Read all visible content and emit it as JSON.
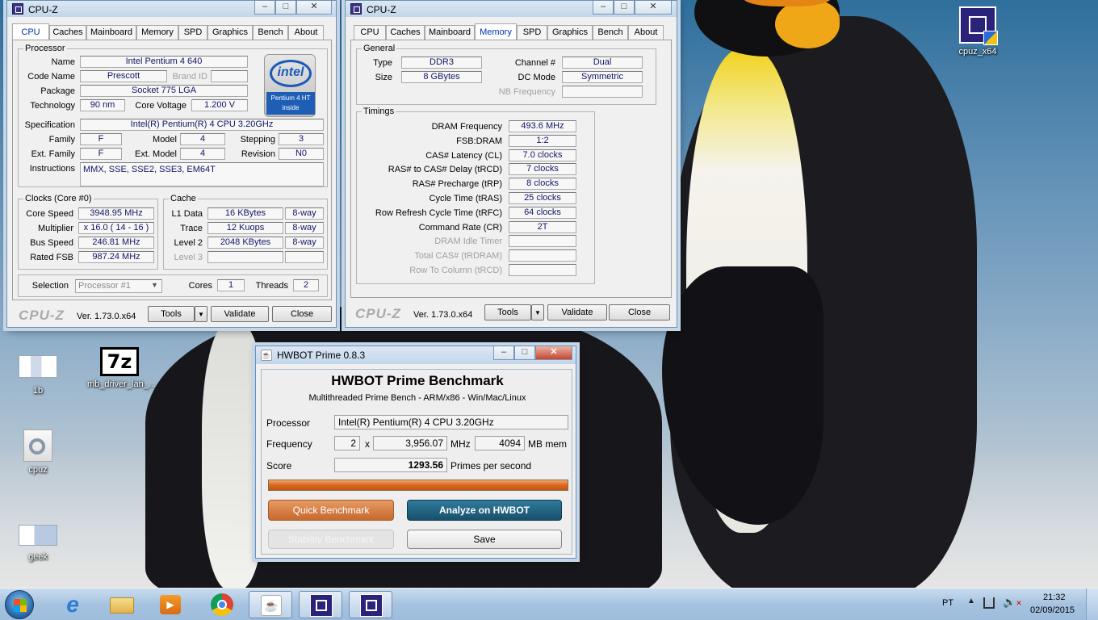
{
  "cpuz_cpu": {
    "title": "CPU-Z",
    "tabs": [
      "CPU",
      "Caches",
      "Mainboard",
      "Memory",
      "SPD",
      "Graphics",
      "Bench",
      "About"
    ],
    "processor": {
      "group_title": "Processor",
      "name_label": "Name",
      "name": "Intel Pentium 4 640",
      "codename_label": "Code Name",
      "codename": "Prescott",
      "brandid_label": "Brand ID",
      "package_label": "Package",
      "package": "Socket 775 LGA",
      "technology_label": "Technology",
      "technology": "90 nm",
      "corevoltage_label": "Core Voltage",
      "corevoltage": "1.200 V",
      "spec_label": "Specification",
      "spec": "Intel(R) Pentium(R) 4 CPU 3.20GHz",
      "family_label": "Family",
      "family": "F",
      "model_label": "Model",
      "model": "4",
      "stepping_label": "Stepping",
      "stepping": "3",
      "extfamily_label": "Ext. Family",
      "extfamily": "F",
      "extmodel_label": "Ext. Model",
      "extmodel": "4",
      "revision_label": "Revision",
      "revision": "N0",
      "instructions_label": "Instructions",
      "instructions": "MMX, SSE, SSE2, SSE3, EM64T",
      "logo_brand": "intel",
      "logo_sub": "Pentium 4 HT inside"
    },
    "clocks": {
      "group_title": "Clocks (Core #0)",
      "corespeed_label": "Core Speed",
      "corespeed": "3948.95 MHz",
      "multiplier_label": "Multiplier",
      "multiplier": "x 16.0 ( 14 - 16 )",
      "busspeed_label": "Bus Speed",
      "busspeed": "246.81 MHz",
      "ratedfsb_label": "Rated FSB",
      "ratedfsb": "987.24 MHz"
    },
    "cache": {
      "group_title": "Cache",
      "l1_label": "L1 Data",
      "l1": "16 KBytes",
      "l1_way": "8-way",
      "trace_label": "Trace",
      "trace": "12 Kuops",
      "trace_way": "8-way",
      "l2_label": "Level 2",
      "l2": "2048 KBytes",
      "l2_way": "8-way",
      "l3_label": "Level 3"
    },
    "selection_label": "Selection",
    "selection": "Processor #1",
    "cores_label": "Cores",
    "cores": "1",
    "threads_label": "Threads",
    "threads": "2",
    "footer": {
      "logo": "CPU-Z",
      "version": "Ver. 1.73.0.x64",
      "tools": "Tools",
      "validate": "Validate",
      "close": "Close"
    }
  },
  "cpuz_mem": {
    "title": "CPU-Z",
    "tabs": [
      "CPU",
      "Caches",
      "Mainboard",
      "Memory",
      "SPD",
      "Graphics",
      "Bench",
      "About"
    ],
    "general": {
      "group_title": "General",
      "type_label": "Type",
      "type": "DDR3",
      "size_label": "Size",
      "size": "8 GBytes",
      "channel_label": "Channel #",
      "channel": "Dual",
      "dcmode_label": "DC Mode",
      "dcmode": "Symmetric",
      "nbfreq_label": "NB Frequency"
    },
    "timings": {
      "group_title": "Timings",
      "rows": [
        {
          "label": "DRAM Frequency",
          "value": "493.6 MHz"
        },
        {
          "label": "FSB:DRAM",
          "value": "1:2"
        },
        {
          "label": "CAS# Latency (CL)",
          "value": "7.0 clocks"
        },
        {
          "label": "RAS# to CAS# Delay (tRCD)",
          "value": "7 clocks"
        },
        {
          "label": "RAS# Precharge (tRP)",
          "value": "8 clocks"
        },
        {
          "label": "Cycle Time (tRAS)",
          "value": "25 clocks"
        },
        {
          "label": "Row Refresh Cycle Time (tRFC)",
          "value": "64 clocks"
        },
        {
          "label": "Command Rate (CR)",
          "value": "2T"
        },
        {
          "label": "DRAM Idle Timer",
          "value": ""
        },
        {
          "label": "Total CAS# (tRDRAM)",
          "value": ""
        },
        {
          "label": "Row To Column (tRCD)",
          "value": ""
        }
      ]
    },
    "footer": {
      "logo": "CPU-Z",
      "version": "Ver. 1.73.0.x64",
      "tools": "Tools",
      "validate": "Validate",
      "close": "Close"
    }
  },
  "hwbot": {
    "title": "HWBOT Prime 0.8.3",
    "heading": "HWBOT Prime Benchmark",
    "subheading": "Multithreaded Prime Bench - ARM/x86 - Win/Mac/Linux",
    "processor_label": "Processor",
    "processor": "Intel(R) Pentium(R) 4 CPU 3.20GHz",
    "frequency_label": "Frequency",
    "threads": "2",
    "x_label": "x",
    "frequency": "3,956.07",
    "mhz_label": "MHz",
    "mem": "4094",
    "mem_label": "MB mem",
    "score_label": "Score",
    "score": "1293.56",
    "score_unit": "Primes per second",
    "progress": 1.0,
    "quick_button": "Quick Benchmark",
    "analyze_button": "Analyze on HWBOT",
    "stability_button": "Stability Benchmark",
    "save_button": "Save"
  },
  "desktop_icons": [
    {
      "label": "cpuz_x64"
    },
    {
      "label": "1b"
    },
    {
      "label": "mb_driver_lan_..."
    },
    {
      "label": "cpuz"
    },
    {
      "label": "geek"
    }
  ],
  "taskbar": {
    "language": "PT",
    "time": "21:32",
    "date": "02/09/2015"
  },
  "colors": {
    "accent_blue": "#0033aa",
    "hwbot_orange": "#d2773e",
    "hwbot_teal": "#1d5f7f"
  }
}
